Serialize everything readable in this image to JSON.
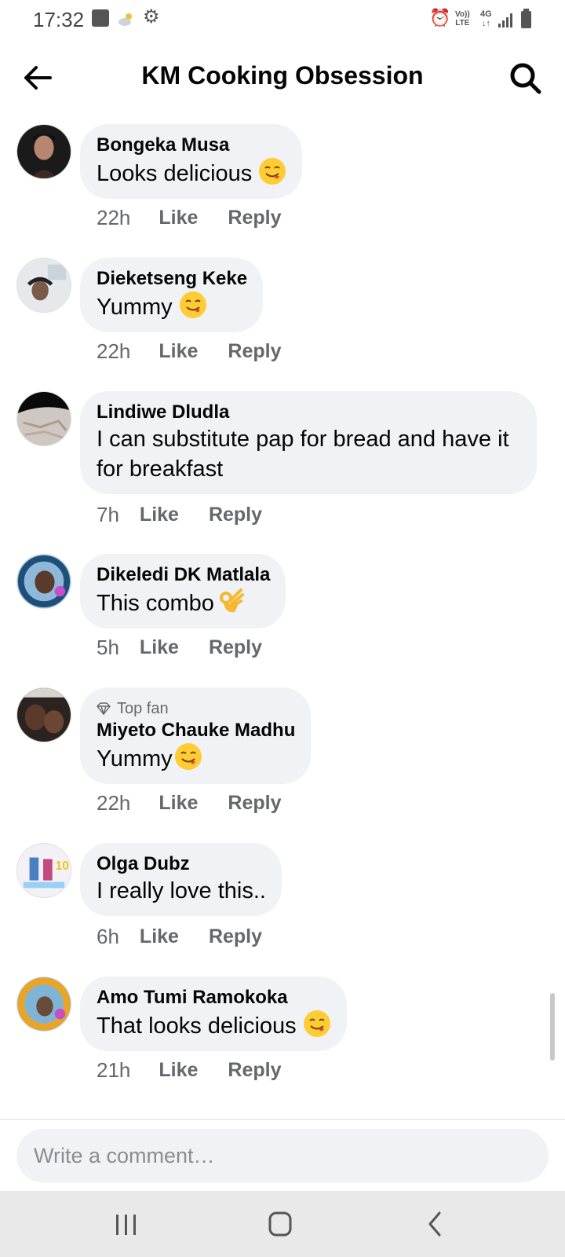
{
  "status_bar": {
    "time": "17:32",
    "volte_top": "Vo))",
    "volte_bottom": "LTE",
    "network": "4G",
    "icons": [
      "gallery-icon",
      "weather-icon",
      "settings-icon",
      "alarm-icon",
      "volte-icon",
      "network-icon",
      "signal-icon",
      "battery-icon"
    ]
  },
  "header": {
    "title": "KM Cooking Obsession",
    "back_icon": "back-arrow-icon",
    "search_icon": "search-icon"
  },
  "actions": {
    "like": "Like",
    "reply": "Reply"
  },
  "comments": [
    {
      "author": "Bongeka Musa",
      "text": "Looks delicious",
      "emoji": "savoring-face",
      "time": "22h"
    },
    {
      "author": "Dieketseng Keke",
      "text": "Yummy",
      "emoji": "savoring-face",
      "time": "22h"
    },
    {
      "author": "Lindiwe Dludla",
      "text": "I can substitute pap for bread and have it for breakfast",
      "time": "7h"
    },
    {
      "author": "Dikeledi DK Matlala",
      "text": "This combo",
      "emoji": "ok-hand",
      "time": "5h"
    },
    {
      "badge": "Top fan",
      "author": "Miyeto Chauke Madhu",
      "text": "Yummy",
      "emoji": "savoring-face",
      "time": "22h"
    },
    {
      "author": "Olga Dubz",
      "text": "I really love this..",
      "time": "6h"
    },
    {
      "author": "Amo Tumi Ramokoka",
      "text": "That looks delicious",
      "emoji": "savoring-face",
      "time": "21h"
    }
  ],
  "composer": {
    "placeholder": "Write a comment…"
  },
  "nav": {
    "icons": [
      "recent-apps-icon",
      "home-icon",
      "back-icon"
    ]
  },
  "colors": {
    "bubble": "#f0f2f5",
    "meta_text": "#65676b",
    "text": "#050505",
    "navbar": "#e9e9e9"
  }
}
